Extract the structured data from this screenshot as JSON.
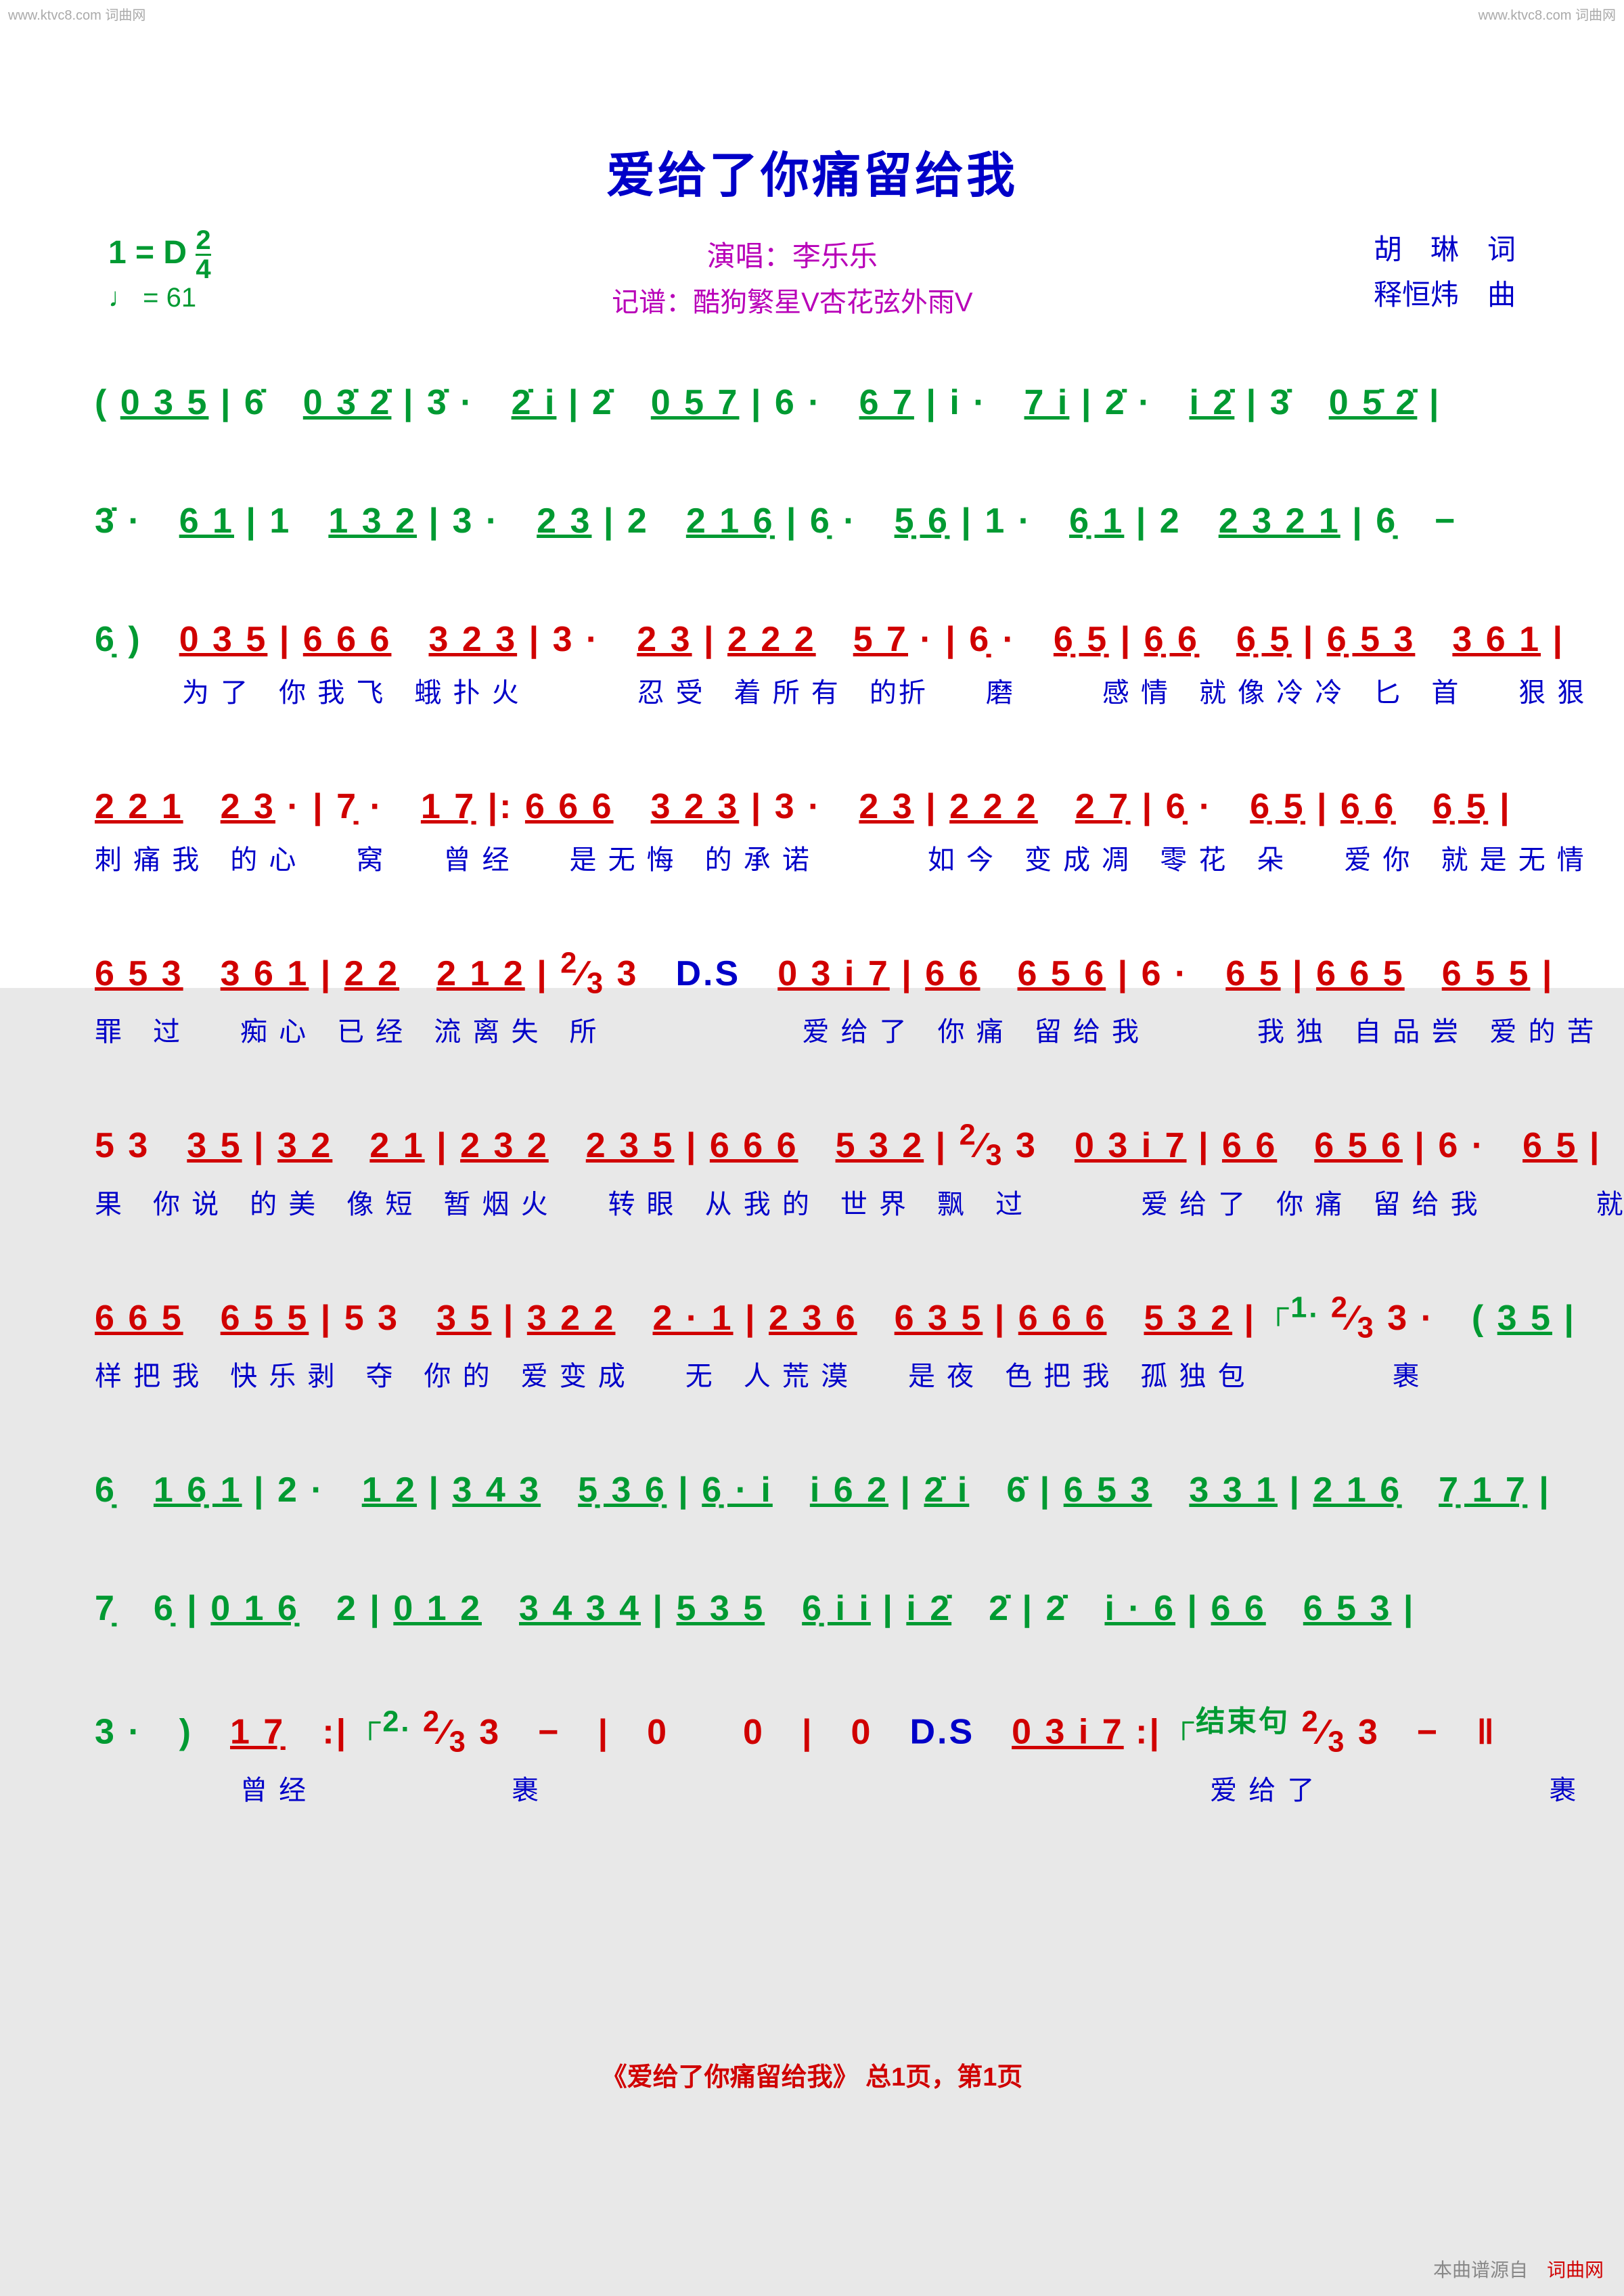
{
  "watermark": "www.ktvc8.com 词曲网",
  "title": "爱给了你痛留给我",
  "key_label": "1 = D",
  "time_sig_num": "2",
  "time_sig_den": "4",
  "tempo": "♩ = 61",
  "singer_label": "演唱：",
  "singer": "李乐乐",
  "transcriber_label": "记谱：",
  "transcriber": "酷狗繁星V杏花弦外雨V",
  "lyricist": "胡　琳　词",
  "composer": "释恒炜　曲",
  "lines": [
    {
      "notes_html": "<span class='g'>( <u>0 3 5</u> | 6̇　<u>0 3̇ 2̇</u> | 3̇ ·　<u>2̇ i</u> | 2̇　<u>0 5 7</u> | 6 ·　<u>6 7</u> | i ·　<u>7 i</u> | 2̇ ·　<u>i 2̇</u> | 3̇　<u>0 5̇ 2̇</u> |</span>",
      "lyrics": ""
    },
    {
      "notes_html": "<span class='g'>3̇ ·　<u>6 1</u> | 1　<u>1 3 2</u> | 3 ·　<u>2 3</u> | 2　<u>2 1 6̣</u> | 6̣ ·　<u>5̣ 6̣</u> | 1 ·　<u>6̣ 1</u> | 2　<u>2 3 2 1</u> | 6̣　−</span>",
      "lyrics": ""
    },
    {
      "notes_html": "<span class='g'>6̣ )　</span><span class='r'><u>0 3 5</u> | <u>6 6 6</u>　<u>3 2 3</u> | 3 ·　<u>2 3</u> | <u>2 2 2</u>　<u>5 7</u> · | 6̣ ·　<u>6̣ 5̣</u> | <u>6̣ 6̣</u>　<u>6̣ 5̣</u> | <u>6̣ 5 3</u>　<u>3 6 1</u> |</span>",
      "lyrics": "　　　为 了　你 我 飞　蛾 扑 火　　　　忍 受　着 所 有　的折　　磨　　　感 情　就 像 冷 冷　匕　首　　狠 狠"
    },
    {
      "notes_html": "<span class='r'><u>2 2 1</u>　<u>2 3</u> · | 7̣ ·　<u>1 7̣</u> |: <u>6 6 6</u>　<u>3 2 3</u> | 3 ·　<u>2 3</u> | <u>2 2 2</u>　<u>2 7̣</u> | 6̣ ·　<u>6̣ 5̣</u> | <u>6̣ 6̣</u>　<u>6̣ 5̣</u> |</span>",
      "lyrics": "刺 痛 我　的 心　　窝　　曾 经　　是 无 悔　的 承 诺　　　　如 今　变 成 凋　零 花　朵　　爱 你　就 是 无 情"
    },
    {
      "notes_html": "<span class='r'><u>6 5 3</u>　<u>3 6 1</u> | <u>2 2</u>　<u>2 1 2</u> | <sup>2</sup>⁄<sub>3</sub> 3　</span><span class='d'>D.S</span><span class='r'>　<u>0 3 i 7</u> | <u>6 6</u>　<u>6 5 6</u> | 6 ·　<u>6 5</u> | <u>6 6 5</u>　<u>6 5 5</u> |</span>",
      "lyrics": "罪　过　　痴 心　已 经　流 离 失　所　　　　　　　爱 给 了　你 痛　留 给 我　　　　我 独　自 品 尝　爱 的 苦"
    },
    {
      "notes_html": "<span class='r'>5 3　<u>3 5</u> | <u>3 2</u>　<u>2 1</u> | <u>2 3 2</u>　<u>2 3 5</u> | <u>6 6 6</u>　<u>5 3 2</u> | <sup>2</sup>⁄<sub>3</sub> 3　<u>0 3 i 7</u> | <u>6 6</u>　<u>6 5 6</u> | 6 ·　<u>6 5</u> |</span>",
      "lyrics": "果　你 说　的 美　像 短　暂 烟 火　　转 眼　从 我 的　世 界　飘　过　　　　爱 给 了　你 痛　留 给 我　　　　就 这"
    },
    {
      "notes_html": "<span class='r'><u>6 6 5</u>　<u>6 5 5</u> | 5 3　<u>3 5</u> | <u>3 2 2</u>　<u>2 · 1</u> | <u>2 3 6</u>　<u>6 3 5</u> | <u>6 6 6</u>　<u>5 3 2</u> | </span><span class='g'><sup>┌1.</sup></span><span class='r'> <sup>2</sup>⁄<sub>3</sub> 3 ·　</span><span class='g'>( <u>3 5</u> |</span>",
      "lyrics": "样 把 我　快 乐 剥　夺　你 的　爱 变 成　　无　人 荒 漠　　是 夜　色 把 我　孤 独 包　　　　　裹"
    },
    {
      "notes_html": "<span class='g'>6̣　<u>1 6̣ 1</u> | 2 ·　<u>1 2</u> | <u>3 4 3</u>　<u>5̣ 3 6̣</u> | <u>6̣ · i</u>　<u>i 6 2</u> | <u>2̇ i</u>　6̇ | <u>6 5 3</u>　<u>3 3 1</u> | <u>2 1 6̣</u>　<u>7̣ 1 7̣</u> |</span>",
      "lyrics": ""
    },
    {
      "notes_html": "<span class='g'>7̣　6̣ | <u>0 1 6̣</u>　2 | <u>0 1 2</u>　<u>3 4 3 4</u> | <u>5 3 5</u>　<u>6̣ i i</u> | <u>i 2̇</u>　2̇ | 2̇　<u>i · 6</u> | <u>6 6</u>　<u>6 5 3</u> |</span>",
      "lyrics": ""
    },
    {
      "notes_html": "<span class='g'>3 ·　)　</span><span class='r'><u>1 7̣</u>　:| </span><span class='g'><sup>┌2.</sup></span><span class='r'> <sup>2</sup>⁄<sub>3</sub> 3　−　|　0　　0　|　0　</span><span class='d'>D.S</span><span class='r'>　<u>0 3 i 7</u> :| </span><span class='g'><sup>┌结束句</sup></span><span class='r'> <sup>2</sup>⁄<sub>3</sub> 3　−　‖</span>",
      "lyrics": "　　　　　曾 经　　　　　　　裹　　　　　　　　　　　　　　　　　　　　　　　爱 给 了　　　　　　　　裹"
    }
  ],
  "footer": "《爱给了你痛留给我》 总1页，第1页",
  "source_prefix": "本曲谱源自　",
  "source_name": "词曲网"
}
